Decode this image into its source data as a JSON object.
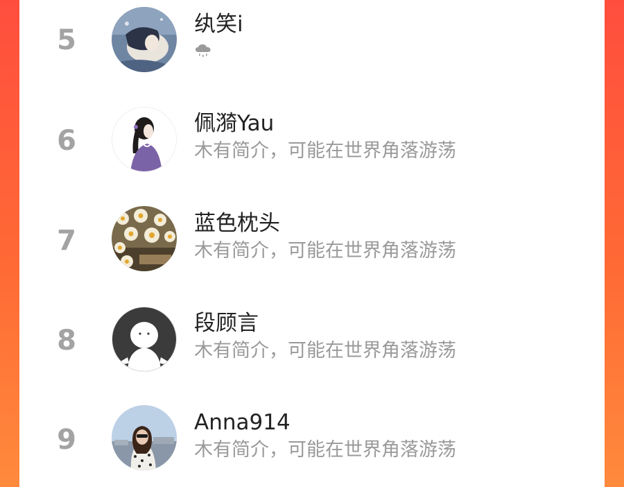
{
  "ranking": {
    "items": [
      {
        "rank": "5",
        "name": "纨笑i",
        "bio": "",
        "bio_icon": "cloud-rain-icon"
      },
      {
        "rank": "6",
        "name": "佩漪Yau",
        "bio": "木有简介，可能在世界角落游荡"
      },
      {
        "rank": "7",
        "name": "蓝色枕头",
        "bio": "木有简介，可能在世界角落游荡"
      },
      {
        "rank": "8",
        "name": "段顾言",
        "bio": "木有简介，可能在世界角落游荡"
      },
      {
        "rank": "9",
        "name": "Anna914",
        "bio": "木有简介，可能在世界角落游荡"
      }
    ]
  },
  "colors": {
    "background_gradient_top": "#ff4e3e",
    "background_gradient_bottom": "#ff8a3c",
    "rank_number": "#a3a3a3",
    "name_text": "#222222",
    "bio_text": "#9a9a9a"
  }
}
